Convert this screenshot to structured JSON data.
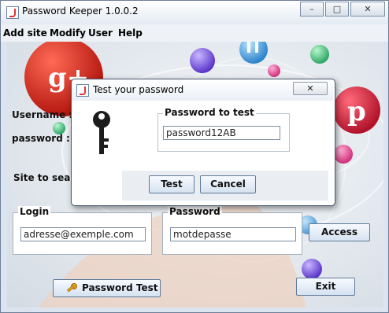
{
  "window": {
    "title": "Password Keeper 1.0.0.2"
  },
  "menu": [
    "Add site",
    "Modify",
    "User",
    "Help"
  ],
  "main": {
    "username_label": "Username :",
    "password_label": "password :",
    "site_search_label": "Site to search",
    "login_group": {
      "label": "Login",
      "value": "adresse@exemple.com"
    },
    "password_group": {
      "label": "Password",
      "value": "motdepasse"
    },
    "access_button": "Access",
    "password_test_button": "Password Test",
    "exit_button": "Exit",
    "social_icons": {
      "google_plus": "g+",
      "twitter": "t"
    }
  },
  "dialog": {
    "title": "Test your password",
    "group_label": "Password to test",
    "password_value": "password12AB",
    "test_button": "Test",
    "cancel_button": "Cancel"
  },
  "colors": {
    "google_red": "#d42a1f",
    "pinterest_red": "#d21f33",
    "button_blue": "#d5e2f1"
  }
}
